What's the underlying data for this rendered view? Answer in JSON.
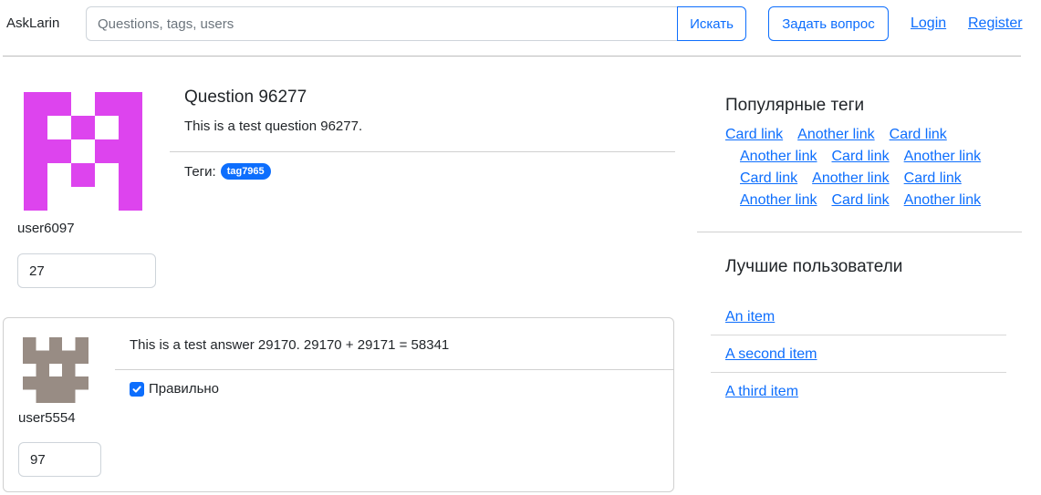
{
  "header": {
    "brand": "AskLarin",
    "search_placeholder": "Questions, tags, users",
    "search_button": "Искать",
    "ask_button": "Задать вопрос",
    "login": "Login",
    "register": "Register"
  },
  "question": {
    "username": "user6097",
    "rating": "27",
    "title": "Question 96277",
    "text": "This is a test question 96277.",
    "tags_label": "Теги:",
    "tag": "tag7965",
    "avatar_color": "#dd44ee"
  },
  "answer": {
    "username": "user5554",
    "rating": "97",
    "text": "This is a test answer 29170. 29170 + 29171 = 58341",
    "correct_label": "Правильно",
    "correct_checked": true,
    "avatar_color": "#988c84"
  },
  "sidebar": {
    "popular_tags_title": "Популярные теги",
    "tag_rows": [
      [
        "Card link",
        "Another link",
        "Card link"
      ],
      [
        "Another link",
        "Card link",
        "Another link"
      ],
      [
        "Card link",
        "Another link",
        "Card link"
      ],
      [
        "Another link",
        "Card link",
        "Another link"
      ]
    ],
    "best_users_title": "Лучшие пользователи",
    "best_users": [
      "An item",
      "A second item",
      "A third item"
    ]
  },
  "colors": {
    "accent": "#0d6efd"
  }
}
